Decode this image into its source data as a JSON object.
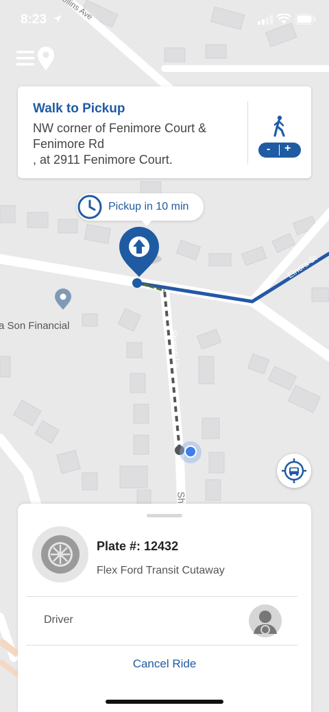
{
  "status_bar": {
    "time": "8:23"
  },
  "map": {
    "poi_label": "a Son Financial",
    "street_labels": [
      "Collins Ave",
      "Elnora St",
      "Sharon Ln",
      "Sh"
    ]
  },
  "walk_card": {
    "title": "Walk to Pickup",
    "address_line1": "NW corner of Fenimore Court &",
    "address_line2": "Fenimore Rd",
    "address_line3": ", at 2911 Fenimore Court.",
    "zoom_minus": "-",
    "zoom_plus": "+"
  },
  "pickup_bubble": {
    "text": "Pickup in 10 min"
  },
  "sheet": {
    "plate": "Plate #: 12432",
    "vehicle": "Flex Ford Transit Cutaway",
    "driver_label": "Driver",
    "cancel": "Cancel Ride"
  },
  "colors": {
    "accent": "#1f5ba3",
    "route": "#2458a6",
    "map_bg": "#e9e9ea"
  },
  "icons": [
    "menu-icon",
    "map-pin-icon",
    "walking-person-icon",
    "clock-icon",
    "pickup-pin-icon",
    "poi-pin-icon",
    "user-location-dot-icon",
    "recenter-vehicle-icon",
    "wheel-icon",
    "driver-avatar-icon",
    "signal-icon",
    "wifi-icon",
    "battery-icon",
    "location-arrow-icon"
  ]
}
